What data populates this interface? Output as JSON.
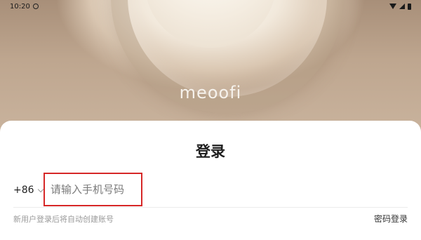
{
  "status_bar": {
    "time": "10:20"
  },
  "hero": {
    "logo_text": "meoofi"
  },
  "login": {
    "title": "登录",
    "country_code": "+86",
    "phone_placeholder": "请输入手机号码",
    "hint": "新用户登录后将自动创建账号",
    "password_login": "密码登录"
  },
  "colors": {
    "highlight_border": "#d62828",
    "hero_tone": "#bea68f"
  },
  "icons": [
    "clock-icon",
    "wifi-icon",
    "signal-icon",
    "battery-icon",
    "chevron-down-icon"
  ]
}
